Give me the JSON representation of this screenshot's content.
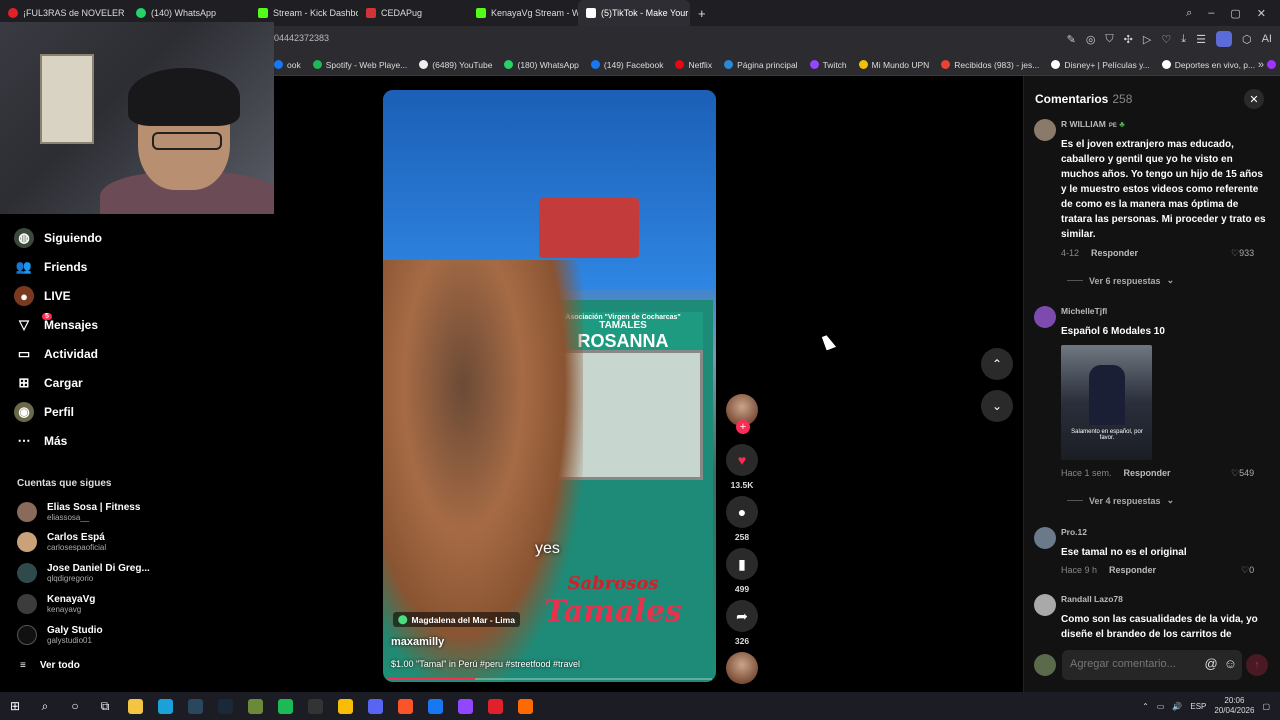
{
  "browser": {
    "tabs": [
      {
        "label": "¡FUL3RAS de NOVELER",
        "color": "#e02020"
      },
      {
        "label": "(140) WhatsApp",
        "color": "#25d366"
      },
      {
        "label": "Stream - Kick Dashboard",
        "color": "#53fc18"
      },
      {
        "label": "CEDAPug",
        "color": "#d13438"
      },
      {
        "label": "KenayaVg Stream - Watch",
        "color": "#53fc18"
      },
      {
        "label": "(5)TikTok - Make Your",
        "color": "#ffffff"
      }
    ],
    "url": "04442372383",
    "bookmarks": [
      {
        "label": "ook",
        "color": "#1877f2"
      },
      {
        "label": "Spotify - Web Playe...",
        "color": "#1db954"
      },
      {
        "label": "(6489) YouTube",
        "color": "#eeeeee"
      },
      {
        "label": "(180) WhatsApp",
        "color": "#25d366"
      },
      {
        "label": "(149) Facebook",
        "color": "#1877f2"
      },
      {
        "label": "Netflix",
        "color": "#e50914"
      },
      {
        "label": "Página principal",
        "color": "#2b88d8"
      },
      {
        "label": "Twitch",
        "color": "#9146ff"
      },
      {
        "label": "Mi Mundo UPN",
        "color": "#f2c200"
      },
      {
        "label": "Recibidos (983) - jes...",
        "color": "#ea4335"
      },
      {
        "label": "Disney+ | Películas y...",
        "color": "#ffffff"
      },
      {
        "label": "Deportes en vivo, p...",
        "color": "#ffffff"
      },
      {
        "label": "Messenger",
        "color": "#a033ff"
      }
    ]
  },
  "sidebar": {
    "items": [
      {
        "label": "Siguiendo",
        "icon": "following-icon"
      },
      {
        "label": "Friends",
        "icon": "friends-icon"
      },
      {
        "label": "LIVE",
        "icon": "live-icon"
      },
      {
        "label": "Mensajes",
        "icon": "messages-icon",
        "badge": "5"
      },
      {
        "label": "Actividad",
        "icon": "activity-icon"
      },
      {
        "label": "Cargar",
        "icon": "upload-icon"
      },
      {
        "label": "Perfil",
        "icon": "profile-icon"
      },
      {
        "label": "Más",
        "icon": "more-icon"
      }
    ],
    "following_title": "Cuentas que sigues",
    "accounts": [
      {
        "name": "Elias Sosa | Fitness",
        "handle": "eliassosa__"
      },
      {
        "name": "Carlos Espá",
        "handle": "carlosespaoficial"
      },
      {
        "name": "Jose Daniel Di Greg...",
        "handle": "qlqdigregorio"
      },
      {
        "name": "KenayaVg",
        "handle": "kenayavg"
      },
      {
        "name": "Galy Studio",
        "handle": "galystudio01"
      }
    ],
    "see_all": "Ver todo"
  },
  "video": {
    "caption_overlay": "yes",
    "location": "Magdalena del Mar - Lima",
    "username": "maxamilly",
    "description": "$1.00 \"Tamal\" in Perú #peru #streetfood #travel",
    "sign_small": "Asociación \"Virgen de Cocharcas\"",
    "sign_top": "TAMALES",
    "sign_name": "ROSANNA",
    "painted_text_1": "Sabrosos",
    "painted_text_2": "Tamales",
    "progress": 0.27
  },
  "actions": {
    "likes": "13.5K",
    "comments": "258",
    "saves": "499",
    "shares": "326"
  },
  "comments_panel": {
    "title": "Comentarios",
    "count": "258",
    "items": [
      {
        "author": "R WILLIAM",
        "body": "Es el joven extranjero mas educado, caballero y gentil que yo he visto en muchos años. Yo tengo un hijo de 15 años y le muestro estos videos como referente de como es la manera mas óptima de tratara las personas. Mi proceder y trato es similar.",
        "date": "4-12",
        "reply": "Responder",
        "likes": "933",
        "more": "Ver 6 respuestas",
        "avatar_color": "#8a7a6a"
      },
      {
        "author": "MichelleTjfl",
        "body": "Español 6 Modales 10",
        "date": "Hace 1 sem.",
        "reply": "Responder",
        "likes": "549",
        "more": "Ver 4 respuestas",
        "image_subtitle": "Salamento en español, por favor.",
        "avatar_color": "#7d4bb0"
      },
      {
        "author": "Pro.12",
        "body": "Ese tamal no es el original",
        "date": "Hace 9 h",
        "reply": "Responder",
        "likes": "0",
        "avatar_color": "#6a7a8a"
      },
      {
        "author": "Randall Lazo78",
        "body": "Como son las casualidades de la vida, yo diseñe el brandeo de los carritos de",
        "avatar_color": "#a9a9a9"
      }
    ],
    "input_placeholder": "Agregar comentario..."
  },
  "taskbar": {
    "lang": "ESP",
    "time": "20:06",
    "date": "20/04/2026",
    "apps": [
      {
        "name": "file-explorer",
        "color": "#f4c542"
      },
      {
        "name": "edge",
        "color": "#1ba0d7"
      },
      {
        "name": "steam-like",
        "color": "#2a475e"
      },
      {
        "name": "steam",
        "color": "#1b2838"
      },
      {
        "name": "app-green",
        "color": "#6a8a3a"
      },
      {
        "name": "spotify",
        "color": "#1db954"
      },
      {
        "name": "epic",
        "color": "#333333"
      },
      {
        "name": "chrome",
        "color": "#fbbc05"
      },
      {
        "name": "discord",
        "color": "#5865f2"
      },
      {
        "name": "brave",
        "color": "#fb542b"
      },
      {
        "name": "facebook",
        "color": "#1877f2"
      },
      {
        "name": "twitch",
        "color": "#9146ff"
      },
      {
        "name": "opera",
        "color": "#e0202a"
      },
      {
        "name": "app-orange",
        "color": "#ff6a00"
      }
    ]
  }
}
